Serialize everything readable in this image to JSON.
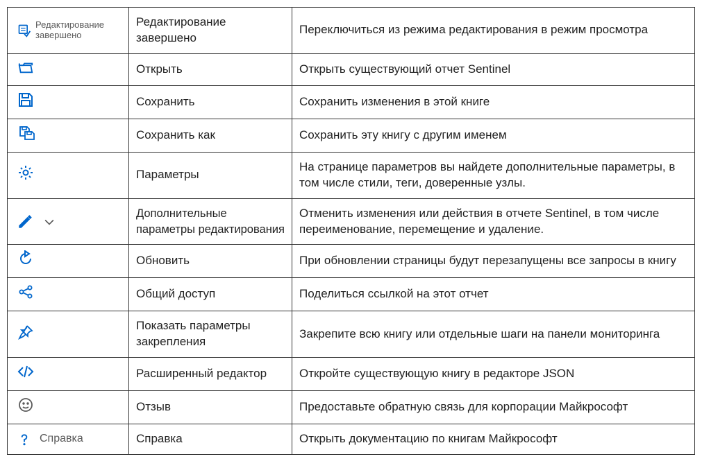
{
  "colors": {
    "accent": "#0066cc",
    "muted": "#5a5a5a",
    "border": "#333"
  },
  "rows": [
    {
      "icon": "edit-done-icon",
      "icon_label": "Редактирование завершено",
      "name": "Редактирование завершено",
      "desc": "Переключиться из режима редактирования в режим просмотра"
    },
    {
      "icon": "open-icon",
      "name": "Открыть",
      "desc": "Открыть существующий отчет Sentinel"
    },
    {
      "icon": "save-icon",
      "name": "Сохранить",
      "desc": "Сохранить изменения в этой книге"
    },
    {
      "icon": "save-as-icon",
      "name": "Сохранить как",
      "desc": "Сохранить эту книгу с другим именем"
    },
    {
      "icon": "settings-icon",
      "name": "Параметры",
      "desc": "На странице параметров вы найдете дополнительные параметры, в том числе стили, теги, доверенные узлы."
    },
    {
      "icon": "pencil-chevron-icon",
      "name": "Дополнительные параметры редактирования",
      "name_small": true,
      "desc": "Отменить изменения или действия в отчете Sentinel, в том числе переименование, перемещение и удаление."
    },
    {
      "icon": "refresh-icon",
      "name": "Обновить",
      "desc": "При обновлении страницы будут перезапущены все запросы в книгу"
    },
    {
      "icon": "share-icon",
      "name": "Общий доступ",
      "desc": "Поделиться ссылкой на этот отчет"
    },
    {
      "icon": "pin-icon",
      "name": "Показать параметры закрепления",
      "desc": "Закрепите всю книгу или отдельные шаги на панели мониторинга"
    },
    {
      "icon": "code-icon",
      "name": "Расширенный редактор",
      "desc": "Откройте существующую книгу в редакторе JSON"
    },
    {
      "icon": "feedback-icon",
      "name": "Отзыв",
      "desc": "Предоставьте обратную связь для корпорации Майкрософт"
    },
    {
      "icon": "help-icon",
      "icon_label": "Справка",
      "name": "Справка",
      "desc": "Открыть документацию по книгам Майкрософт"
    }
  ]
}
